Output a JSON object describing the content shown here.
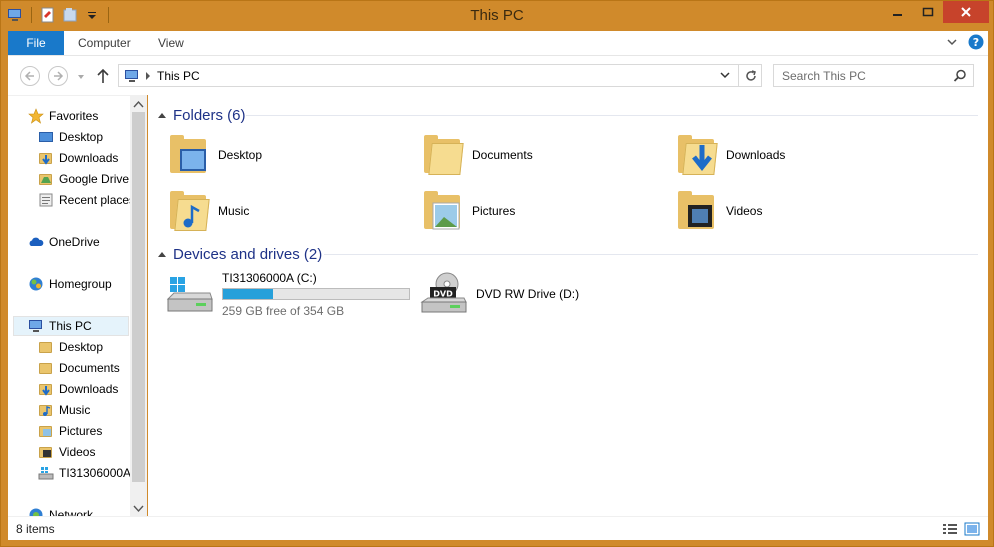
{
  "window": {
    "title": "This PC"
  },
  "ribbon": {
    "tabs": [
      "File",
      "Computer",
      "View"
    ]
  },
  "address": {
    "path": "This PC"
  },
  "search": {
    "placeholder": "Search This PC"
  },
  "nav": {
    "favorites_label": "Favorites",
    "favorites": [
      "Desktop",
      "Downloads",
      "Google Drive",
      "Recent places"
    ],
    "onedrive": "OneDrive",
    "homegroup": "Homegroup",
    "thispc": "This PC",
    "thispc_items": [
      "Desktop",
      "Documents",
      "Downloads",
      "Music",
      "Pictures",
      "Videos",
      "TI31306000A"
    ],
    "network": "Network"
  },
  "folders": {
    "header": "Folders (6)",
    "items": [
      "Desktop",
      "Documents",
      "Downloads",
      "Music",
      "Pictures",
      "Videos"
    ]
  },
  "devices": {
    "header": "Devices and drives (2)",
    "drive_c": {
      "label": "TI31306000A (C:)",
      "free_text": "259 GB free of 354 GB",
      "used_fraction": 0.268
    },
    "drive_d": {
      "label": "DVD RW Drive (D:)"
    }
  },
  "status": {
    "items_text": "8 items"
  },
  "colors": {
    "frame": "#d08a2b",
    "accent": "#1979ca",
    "header_text": "#1e3287",
    "usage_fill": "#26a0da"
  },
  "icons": [
    "computer-icon",
    "star-icon",
    "folder-icon",
    "cloud-icon",
    "homegroup-icon",
    "network-icon",
    "dvd-drive-icon",
    "hard-drive-icon"
  ]
}
